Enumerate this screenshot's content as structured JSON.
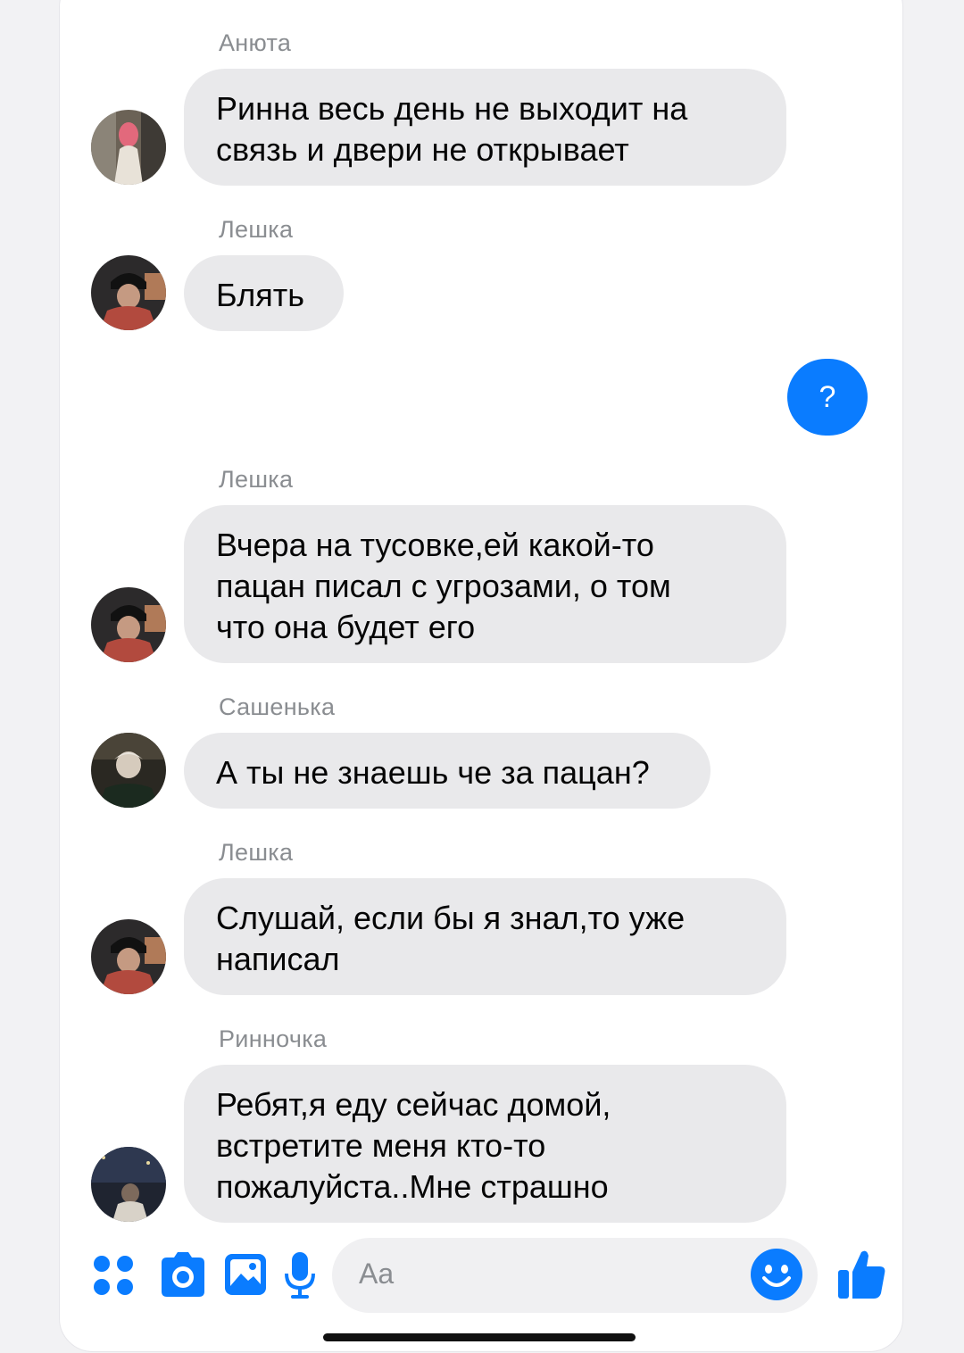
{
  "messages": [
    {
      "sender": "Анюта",
      "lines": [
        "Ринна весь день не выходит на",
        "связь и двери не открывает"
      ],
      "avatar": "avatar-anyuta"
    },
    {
      "sender": "Лешка",
      "lines": [
        "Блять"
      ],
      "avatar": "avatar-leshka"
    },
    {
      "sender": "Лешка",
      "lines": [
        "Вчера на тусовке,ей какой-то",
        "пацан писал с угрозами, о том",
        "что она будет его"
      ],
      "avatar": "avatar-leshka"
    },
    {
      "sender": "Сашенька",
      "lines": [
        "А ты не знаешь че за пацан?"
      ],
      "avatar": "avatar-sashenka"
    },
    {
      "sender": "Лешка",
      "lines": [
        "Слушай, если бы я знал,то уже",
        "написал"
      ],
      "avatar": "avatar-leshka"
    },
    {
      "sender": "Ринночка",
      "lines": [
        "Ребят,я еду сейчас домой,",
        "встретите меня кто-то",
        "пожалуйста..Мне страшно"
      ],
      "avatar": "avatar-rinnochka"
    }
  ],
  "outgoing": {
    "text": "?"
  },
  "composer": {
    "placeholder": "Aa",
    "icons": [
      "apps-icon",
      "camera-icon",
      "gallery-icon",
      "microphone-icon",
      "emoji-icon",
      "thumbs-up-icon"
    ]
  },
  "colors": {
    "accent": "#0a7cff",
    "bubble_incoming": "#e9e9eb",
    "sender_name": "#8a8d91",
    "background": "#ffffff"
  }
}
